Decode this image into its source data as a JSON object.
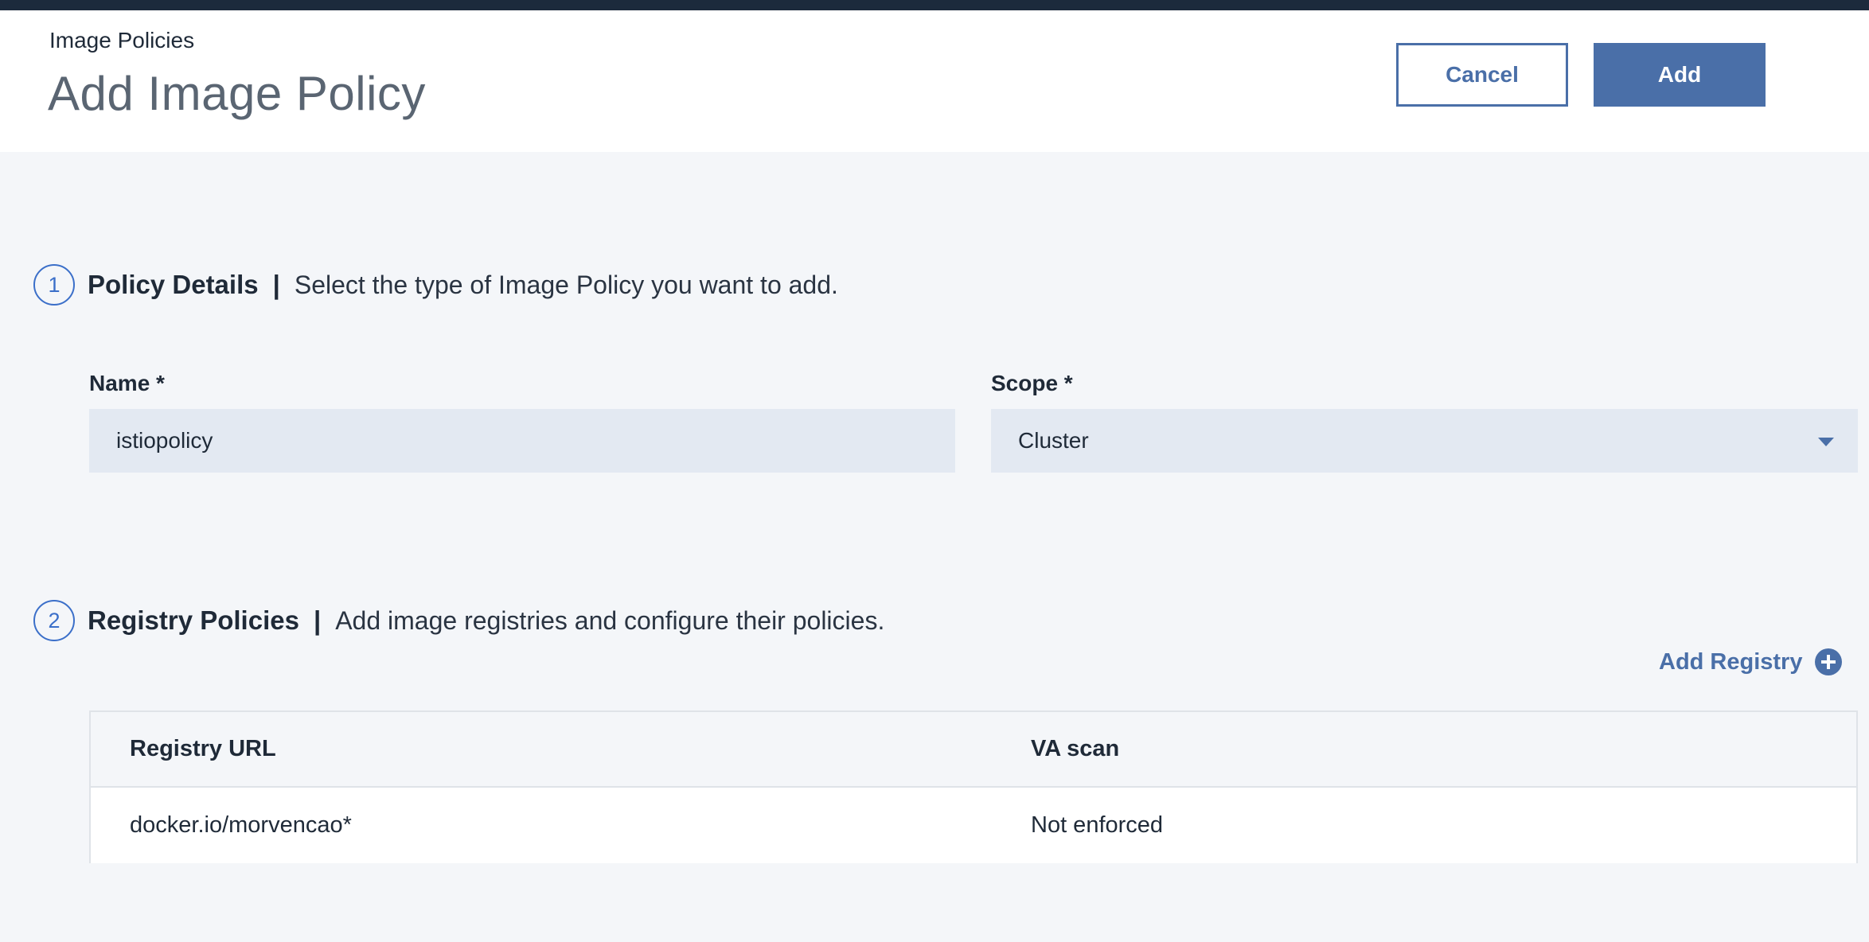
{
  "header": {
    "breadcrumb": "Image Policies",
    "title": "Add Image Policy",
    "cancel_label": "Cancel",
    "add_label": "Add"
  },
  "section1": {
    "number": "1",
    "title": "Policy Details",
    "separator": "|",
    "description": "Select the type of Image Policy you want to add.",
    "name_label": "Name *",
    "name_value": "istiopolicy",
    "scope_label": "Scope *",
    "scope_value": "Cluster"
  },
  "section2": {
    "number": "2",
    "title": "Registry Policies",
    "separator": "|",
    "description": "Add image registries and configure their policies.",
    "add_registry_label": "Add Registry"
  },
  "table": {
    "columns": [
      "Registry URL",
      "VA scan"
    ],
    "rows": [
      [
        "docker.io/morvencao*",
        "Not enforced"
      ]
    ]
  },
  "colors": {
    "accent": "#4a6fa8",
    "topbar": "#1c2a3c",
    "field_bg": "#e3e9f2",
    "page_bg": "#f4f6f9"
  }
}
